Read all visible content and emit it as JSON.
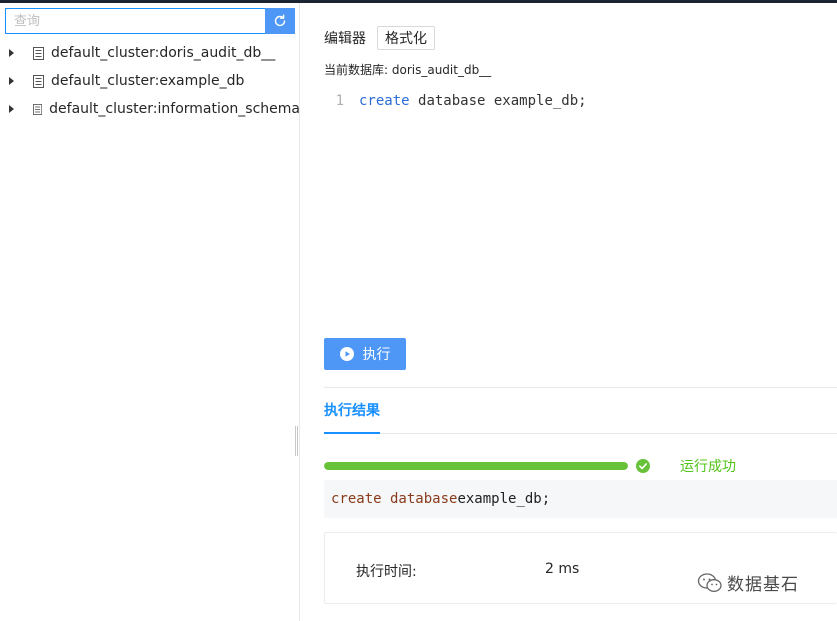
{
  "colors": {
    "primary": "#4e97f7",
    "tab_active": "#1890ff",
    "success": "#67c23a",
    "keyword": "#2b6cd6"
  },
  "sidebar": {
    "search": {
      "placeholder": "查询",
      "refresh_icon": "refresh-icon"
    },
    "tree": [
      {
        "label": "default_cluster:doris_audit_db__",
        "icon": "database-icon"
      },
      {
        "label": "default_cluster:example_db",
        "icon": "database-icon"
      },
      {
        "label": "default_cluster:information_schema",
        "icon": "database-icon"
      }
    ]
  },
  "editor": {
    "title": "编辑器",
    "format_label": "格式化",
    "current_db": "当前数据库: doris_audit_db__",
    "line_number": "1",
    "code_keyword": "create",
    "code_rest": "database example_db;"
  },
  "run_button": {
    "label": "执行",
    "icon": "play-circle-icon"
  },
  "results": {
    "tab_label": "执行结果",
    "progress": 1.0,
    "status": "运行成功",
    "status_icon": "check-circle-icon",
    "sql_keyword": "create database",
    "sql_rest": " example_db;",
    "time_label": "执行时间:",
    "time_value": "2 ms"
  },
  "watermark": {
    "text": "数据基石",
    "icon": "wechat-icon"
  }
}
